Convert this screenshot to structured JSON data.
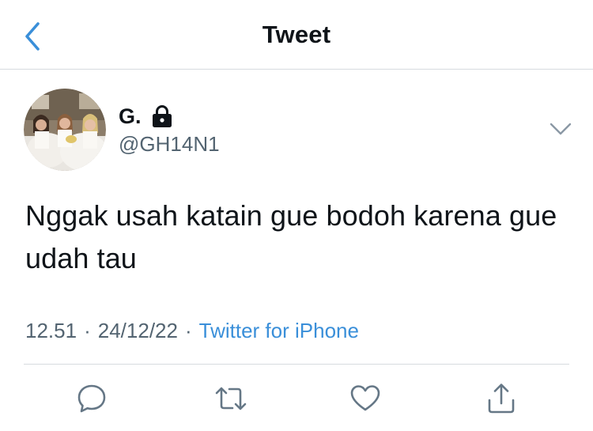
{
  "header": {
    "title": "Tweet",
    "back_icon": "chevron-left-icon",
    "accent_color": "#3a8fd9"
  },
  "author": {
    "display_name": "G.",
    "handle": "@GH14N1",
    "protected_icon": "lock-icon",
    "more_icon": "chevron-down-icon"
  },
  "tweet": {
    "text": "Nggak usah katain gue bodoh karena gue udah tau",
    "time": "12.51",
    "date": "24/12/22",
    "separator": "·",
    "source": "Twitter for iPhone"
  },
  "actions": [
    {
      "name": "reply-icon"
    },
    {
      "name": "retweet-icon"
    },
    {
      "name": "like-icon"
    },
    {
      "name": "share-icon"
    }
  ]
}
